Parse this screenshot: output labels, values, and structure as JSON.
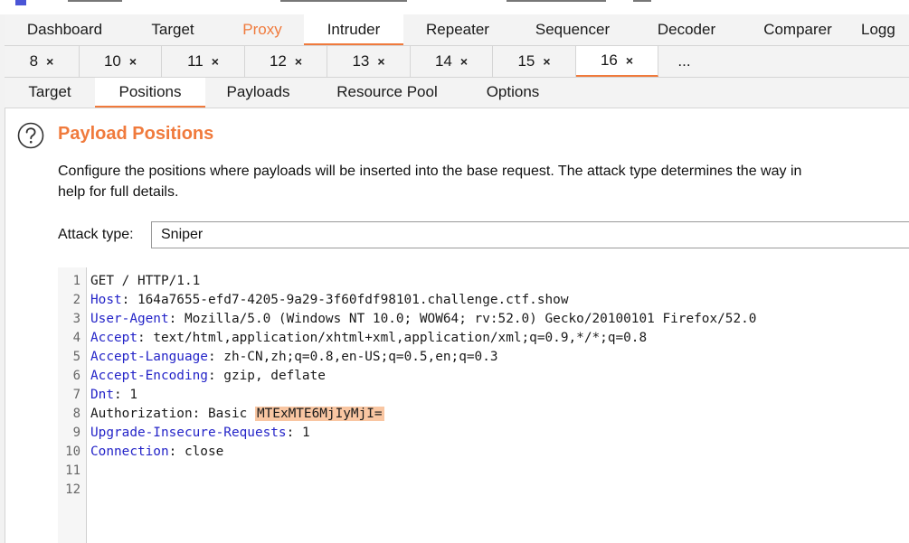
{
  "main_tabs": [
    "Dashboard",
    "Target",
    "Proxy",
    "Intruder",
    "Repeater",
    "Sequencer",
    "Decoder",
    "Comparer",
    "Logg"
  ],
  "sub_tabs": [
    {
      "label": "8",
      "close": "×"
    },
    {
      "label": "10",
      "close": "×"
    },
    {
      "label": "11",
      "close": "×"
    },
    {
      "label": "12",
      "close": "×"
    },
    {
      "label": "13",
      "close": "×"
    },
    {
      "label": "14",
      "close": "×"
    },
    {
      "label": "15",
      "close": "×"
    },
    {
      "label": "16",
      "close": "×"
    }
  ],
  "sub_tabs_more": "...",
  "inner_tabs": [
    "Target",
    "Positions",
    "Payloads",
    "Resource Pool",
    "Options"
  ],
  "section": {
    "title": "Payload Positions",
    "description_line1": "Configure the positions where payloads will be inserted into the base request. The attack type determines the way in",
    "description_line2": "help for full details."
  },
  "attack": {
    "label": "Attack type:",
    "value": "Sniper"
  },
  "request": {
    "line_numbers": [
      "1",
      "2",
      "3",
      "4",
      "5",
      "6",
      "7",
      "8",
      "9",
      "10",
      "11",
      "12"
    ],
    "request_line": "GET / HTTP/1.1",
    "headers": [
      {
        "name": "Host",
        "sep": ": ",
        "value": "164a7655-efd7-4205-9a29-3f60fdf98101.challenge.ctf.show"
      },
      {
        "name": "User-Agent",
        "sep": ": ",
        "value": "Mozilla/5.0 (Windows NT 10.0; WOW64; rv:52.0) Gecko/20100101 Firefox/52.0"
      },
      {
        "name": "Accept",
        "sep": ": ",
        "value": "text/html,application/xhtml+xml,application/xml;q=0.9,*/*;q=0.8"
      },
      {
        "name": "Accept-Language",
        "sep": ": ",
        "value": "zh-CN,zh;q=0.8,en-US;q=0.5,en;q=0.3"
      },
      {
        "name": "Accept-Encoding",
        "sep": ": ",
        "value": "gzip, deflate"
      },
      {
        "name": "Dnt",
        "sep": ": ",
        "value": "1"
      }
    ],
    "auth_line_prefix": "Authorization: Basic ",
    "auth_payload": "MTExMTE6MjIyMjI=",
    "headers_after": [
      {
        "name": "Upgrade-Insecure-Requests",
        "sep": ": ",
        "value": "1"
      },
      {
        "name": "Connection",
        "sep": ": ",
        "value": "close"
      }
    ]
  },
  "colors": {
    "accent": "#f07a3c",
    "header_name": "#2424c8",
    "payload_highlight": "#f9c6a2"
  }
}
